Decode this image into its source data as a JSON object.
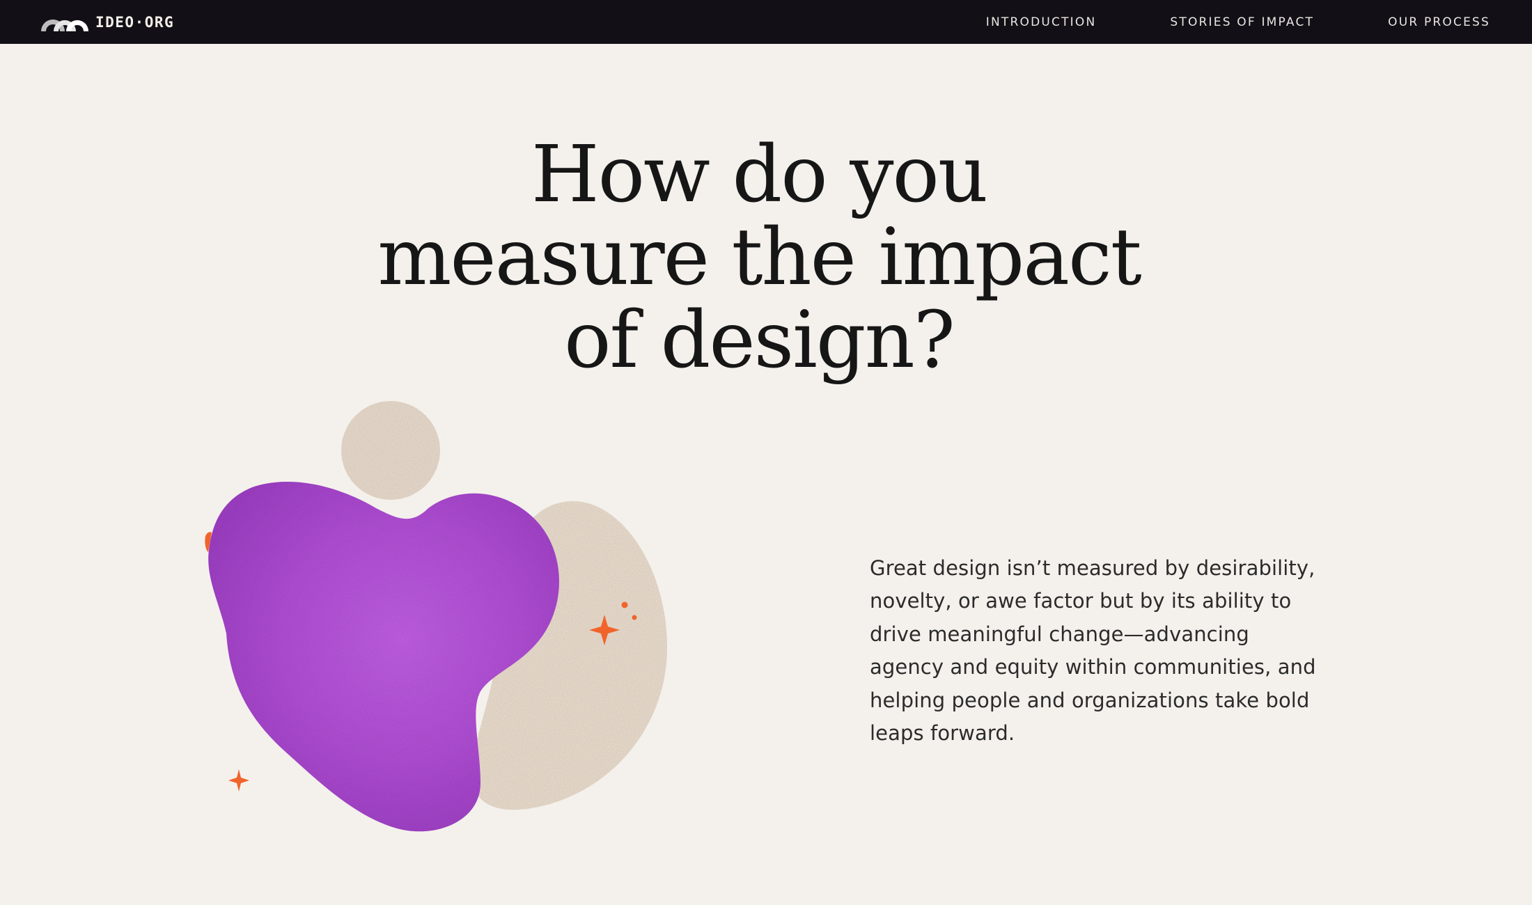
{
  "brand": {
    "logo_text": "IDEO·ORG",
    "logo_icon": "arches-logo-icon"
  },
  "nav": {
    "items": [
      {
        "label": "INTRODUCTION"
      },
      {
        "label": "STORIES OF IMPACT"
      },
      {
        "label": "OUR PROCESS"
      }
    ]
  },
  "hero": {
    "title_lines": [
      "How do you",
      "measure the impact",
      "of design?"
    ],
    "body": "Great design isn’t measured by desirability, novelty, or awe factor but by its ability to drive meaningful change—advancing agency and equity within communities, and helping people and organizations take bold leaps forward."
  },
  "illustration": {
    "icons": [
      "purple-blob-shape",
      "beige-blob-shape",
      "sparkle-icon"
    ]
  },
  "colors": {
    "page_background": "#f4f1ec",
    "navbar_background": "#121016",
    "blob_purple": "#b651dc",
    "blob_beige": "#f3e4d4",
    "sparkle_orange": "#f0642c",
    "text_dark": "#161616"
  }
}
